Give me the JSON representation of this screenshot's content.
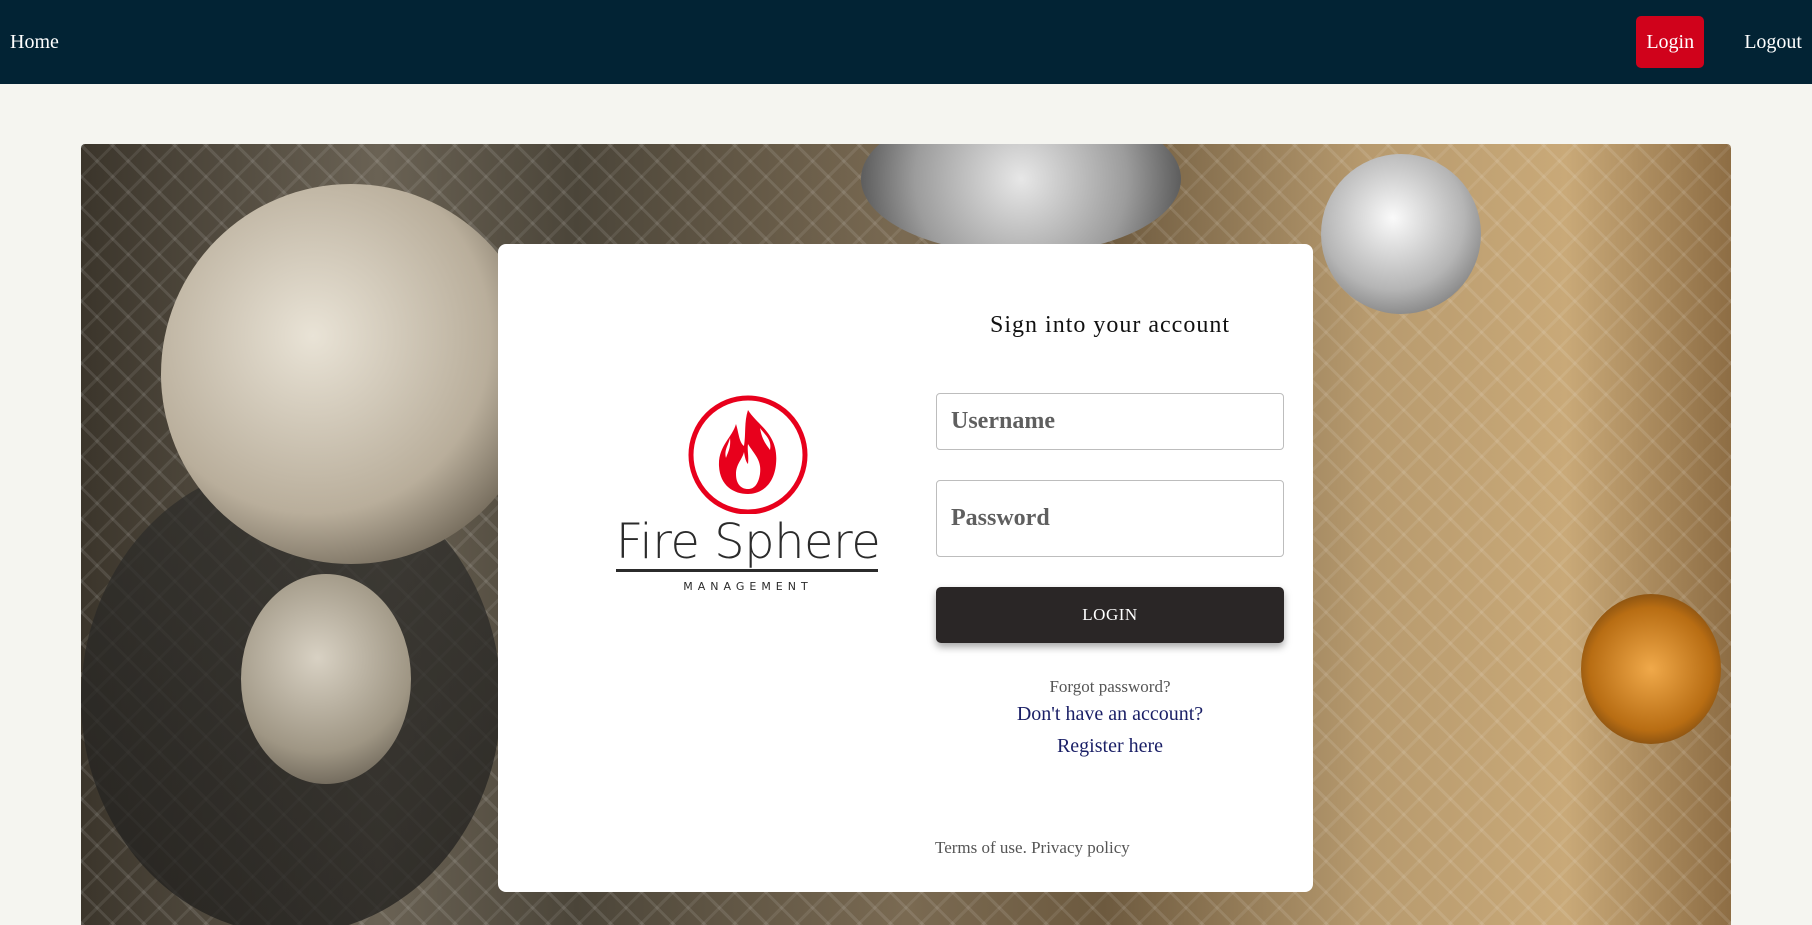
{
  "navbar": {
    "home_label": "Home",
    "login_label": "Login",
    "logout_label": "Logout",
    "background": "#022334",
    "login_color": "#d0021b"
  },
  "logo": {
    "name": "Fire Sphere",
    "subtitle": "MANAGEMENT",
    "icon": "flame-icon",
    "accent": "#e8001c"
  },
  "form": {
    "title": "Sign into your account",
    "username_placeholder": "Username",
    "password_placeholder": "Password",
    "submit_label": "LOGIN",
    "forgot_label": "Forgot password?",
    "no_account_label": "Don't have an account?",
    "register_label": "Register here",
    "terms_label": "Terms of use.",
    "privacy_label": "Privacy policy"
  }
}
